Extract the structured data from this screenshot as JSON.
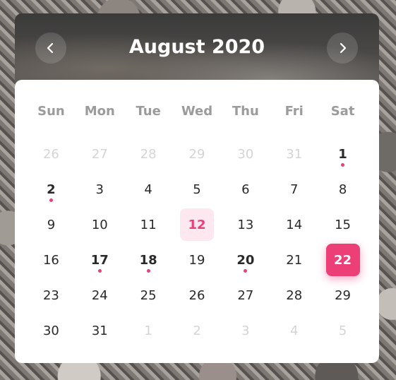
{
  "header": {
    "title": "August 2020",
    "prev_icon": "chevron-left-icon",
    "next_icon": "chevron-right-icon"
  },
  "colors": {
    "accent": "#ec3f77",
    "today_bg": "#fde8ef",
    "muted_text": "#d4d4d4",
    "weekday_text": "#9b9b9b"
  },
  "weekdays": [
    "Sun",
    "Mon",
    "Tue",
    "Wed",
    "Thu",
    "Fri",
    "Sat"
  ],
  "days": [
    {
      "label": "26",
      "muted": true
    },
    {
      "label": "27",
      "muted": true
    },
    {
      "label": "28",
      "muted": true
    },
    {
      "label": "29",
      "muted": true
    },
    {
      "label": "30",
      "muted": true
    },
    {
      "label": "31",
      "muted": true
    },
    {
      "label": "1",
      "event": true
    },
    {
      "label": "2",
      "event": true
    },
    {
      "label": "3"
    },
    {
      "label": "4"
    },
    {
      "label": "5"
    },
    {
      "label": "6"
    },
    {
      "label": "7"
    },
    {
      "label": "8"
    },
    {
      "label": "9"
    },
    {
      "label": "10"
    },
    {
      "label": "11"
    },
    {
      "label": "12",
      "today": true
    },
    {
      "label": "13"
    },
    {
      "label": "14"
    },
    {
      "label": "15"
    },
    {
      "label": "16"
    },
    {
      "label": "17",
      "event": true
    },
    {
      "label": "18",
      "event": true
    },
    {
      "label": "19"
    },
    {
      "label": "20",
      "event": true
    },
    {
      "label": "21"
    },
    {
      "label": "22",
      "selected": true
    },
    {
      "label": "23"
    },
    {
      "label": "24"
    },
    {
      "label": "25"
    },
    {
      "label": "26"
    },
    {
      "label": "27"
    },
    {
      "label": "28"
    },
    {
      "label": "29"
    },
    {
      "label": "30"
    },
    {
      "label": "31"
    },
    {
      "label": "1",
      "muted": true
    },
    {
      "label": "2",
      "muted": true
    },
    {
      "label": "3",
      "muted": true
    },
    {
      "label": "4",
      "muted": true
    },
    {
      "label": "5",
      "muted": true
    }
  ]
}
